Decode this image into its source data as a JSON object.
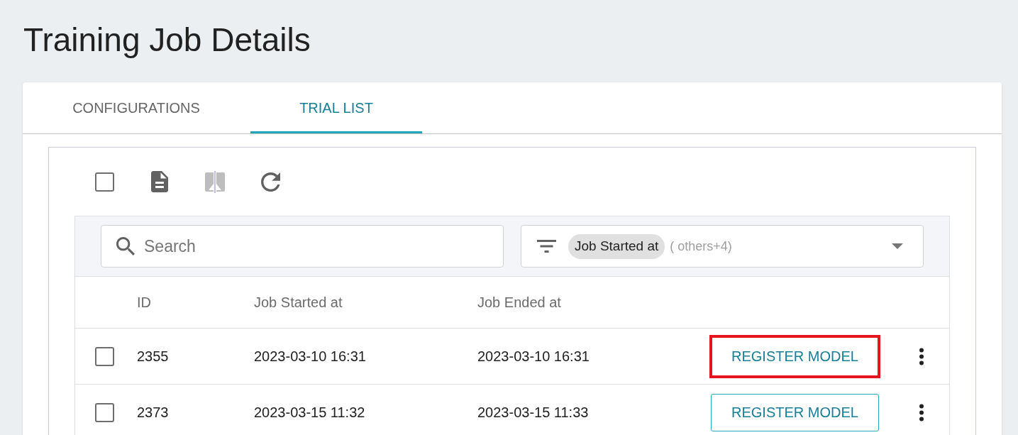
{
  "page": {
    "title": "Training Job Details"
  },
  "tabs": [
    {
      "label": "CONFIGURATIONS",
      "selected": false
    },
    {
      "label": "TRIAL LIST",
      "selected": true
    }
  ],
  "toolbar": [
    {
      "kind": "checkbox",
      "checked": false
    },
    {
      "kind": "document",
      "disabled": false
    },
    {
      "kind": "compare",
      "disabled": true
    },
    {
      "kind": "refresh",
      "disabled": false
    }
  ],
  "search": {
    "placeholder": "Search"
  },
  "filter": {
    "chips": [
      "Job Started at"
    ],
    "more": "( others+4)"
  },
  "table": {
    "columns": [
      "ID",
      "Job Started at",
      "Job Ended at"
    ],
    "rows": [
      {
        "checked": false,
        "id": "2355",
        "started": "2023-03-10 16:31",
        "ended": "2023-03-10 16:31",
        "action": "REGISTER MODEL",
        "highlighted": true
      },
      {
        "checked": false,
        "id": "2373",
        "started": "2023-03-15 11:32",
        "ended": "2023-03-15 11:33",
        "action": "REGISTER MODEL",
        "highlighted": false
      }
    ]
  }
}
